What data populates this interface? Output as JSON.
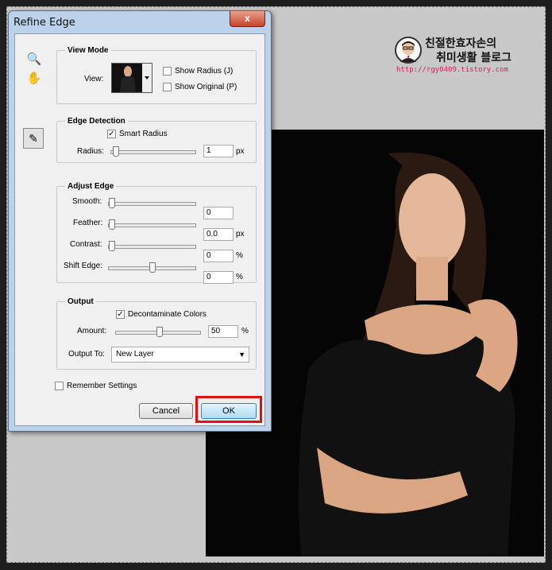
{
  "dialog": {
    "title": "Refine Edge",
    "close_label": "x",
    "view_mode": {
      "legend": "View Mode",
      "view_label": "View:",
      "show_radius": "Show Radius (J)",
      "show_original": "Show Original (P)",
      "show_radius_checked": false,
      "show_original_checked": false
    },
    "edge_detection": {
      "legend": "Edge Detection",
      "smart_radius": "Smart Radius",
      "smart_radius_checked": true,
      "radius_label": "Radius:",
      "radius_value": "1",
      "radius_unit": "px",
      "radius_level": 0.02
    },
    "adjust_edge": {
      "legend": "Adjust Edge",
      "smooth_label": "Smooth:",
      "smooth_value": "0",
      "feather_label": "Feather:",
      "feather_value": "0.0",
      "feather_unit": "px",
      "contrast_label": "Contrast:",
      "contrast_value": "0",
      "contrast_unit": "%",
      "shift_label": "Shift Edge:",
      "shift_value": "0",
      "shift_unit": "%"
    },
    "output": {
      "legend": "Output",
      "decontaminate": "Decontaminate Colors",
      "decontaminate_checked": true,
      "amount_label": "Amount:",
      "amount_value": "50",
      "amount_unit": "%",
      "output_to_label": "Output To:",
      "output_to_value": "New Layer"
    },
    "remember": "Remember Settings",
    "cancel": "Cancel",
    "ok": "OK"
  },
  "watermark": {
    "line1": "친절한효자손의",
    "line2": "취미생활 블로그",
    "url": "http://rgy0409.tistory.com"
  },
  "colors": {
    "highlight": "#e01010",
    "url": "#e0195a"
  }
}
